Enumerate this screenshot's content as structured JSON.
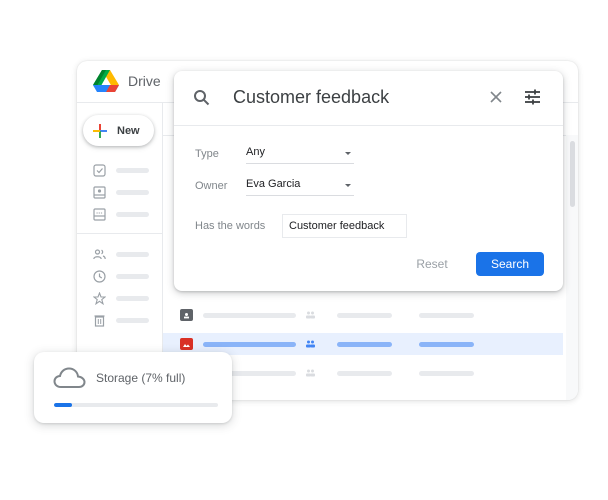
{
  "app": {
    "name": "Drive"
  },
  "sidebar": {
    "new_label": "New",
    "items": [
      {
        "icon": "checkbox-icon"
      },
      {
        "icon": "shared-drive-icon"
      },
      {
        "icon": "computers-icon"
      },
      {
        "icon": "shared-with-me-icon"
      },
      {
        "icon": "recent-icon"
      },
      {
        "icon": "starred-icon"
      },
      {
        "icon": "trash-icon"
      }
    ]
  },
  "search": {
    "query": "Customer feedback",
    "filters": {
      "type_label": "Type",
      "type_value": "Any",
      "owner_label": "Owner",
      "owner_value": "Eva Garcia",
      "words_label": "Has the words",
      "words_value": "Customer feedback"
    },
    "reset_label": "Reset",
    "search_label": "Search"
  },
  "files": [
    {
      "icon": "shared-folder-icon",
      "shared": true,
      "selected": false
    },
    {
      "icon": "image-file-icon",
      "shared": true,
      "selected": true
    },
    {
      "icon": "file-icon",
      "shared": true,
      "selected": false
    }
  ],
  "storage": {
    "label": "Storage (7% full)",
    "percent_used": 7
  },
  "colors": {
    "accent": "#1a73e8",
    "selected_row": "#e8f0fe",
    "selected_bar": "#8ab4f8",
    "image_file": "#d93025"
  }
}
